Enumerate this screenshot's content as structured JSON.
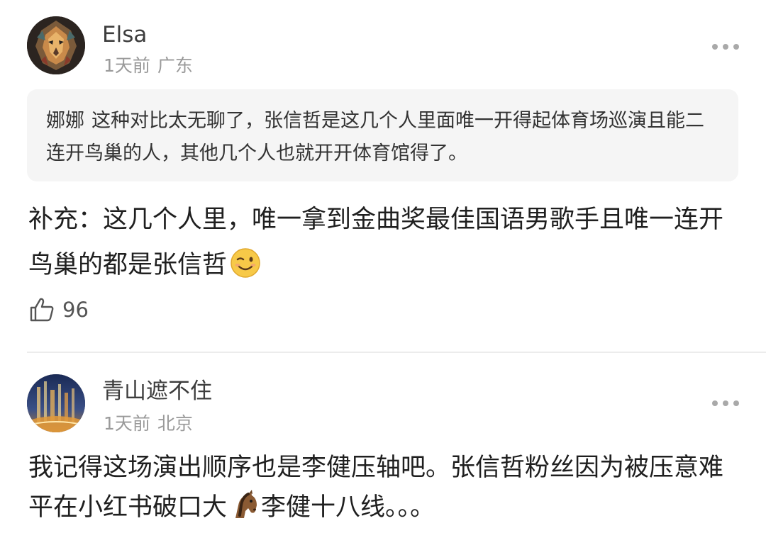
{
  "comments": [
    {
      "username": "Elsa",
      "time": "1天前",
      "location": "广东",
      "quote": {
        "user": "娜娜",
        "text": "这种对比太无聊了，张信哲是这几个人里面唯一开得起体育场巡演且能二连开鸟巢的人，其他几个人也就开开体育馆得了。"
      },
      "text": "补充：这几个人里，唯一拿到金曲奖最佳国语男歌手且唯一连开鸟巢的都是张信哲",
      "emoji": "wink-emoji",
      "likes": "96"
    },
    {
      "username": "青山遮不住",
      "time": "1天前",
      "location": "北京",
      "text_part1": "我记得这场演出顺序也是李健压轴吧。张信哲粉丝因为被压意难平在小红书破口大",
      "emoji": "horse-emoji",
      "text_part2": "李健十八线。。。"
    }
  ],
  "icons": {
    "more": "more-dots-icon",
    "like": "thumbs-up-icon"
  },
  "colors": {
    "quote_bg": "#f5f5f5",
    "meta_text": "#9a9a9a",
    "divider": "#ececec"
  }
}
